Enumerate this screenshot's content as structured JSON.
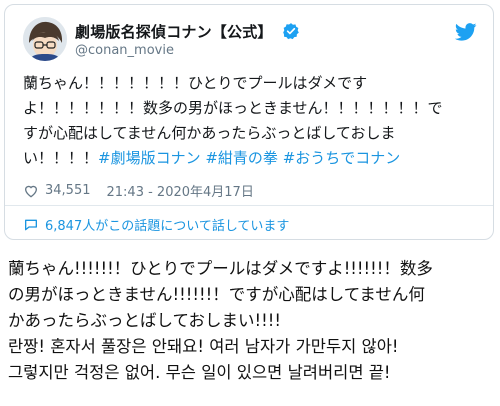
{
  "tweet": {
    "display_name": "劇場版名探偵コナン【公式】",
    "handle": "@conan_movie",
    "text_lines": [
      "蘭ちゃん！！！！！！！ひとりでプールはダメです",
      "よ！！！！！！！数多の男がほっときません！！！！！！！で",
      "すが心配はしてません何かあったらぶっとばしておしま",
      "い！！！！"
    ],
    "hashtags": "#劇場版コナン #紺青の拳 #おうちでコナン",
    "likes": "34,551",
    "timestamp": "21:43 - 2020年4月17日",
    "conversation": "6,847人がこの話題について話しています"
  },
  "translation": {
    "japanese_lines": [
      "蘭ちゃん!!!!!!！ひとりでプールはダメですよ!!!!!!！数多",
      "の男がほっときません!!!!!!！ですが心配はしてません何",
      "かあったらぶっとばしておしまい!!!!"
    ],
    "korean_lines": [
      "란짱! 혼자서 풀장은 안돼요! 여러 남자가 가만두지 않아!",
      "그렇지만 걱정은 없어. 무슨 일이 있으면 날려버리면 끝!"
    ]
  },
  "icons": {
    "verified": "verified-badge-icon",
    "bird": "twitter-bird-icon",
    "heart": "heart-icon",
    "conversation": "speech-bubble-icon",
    "brand_color": "#1da1f2"
  }
}
